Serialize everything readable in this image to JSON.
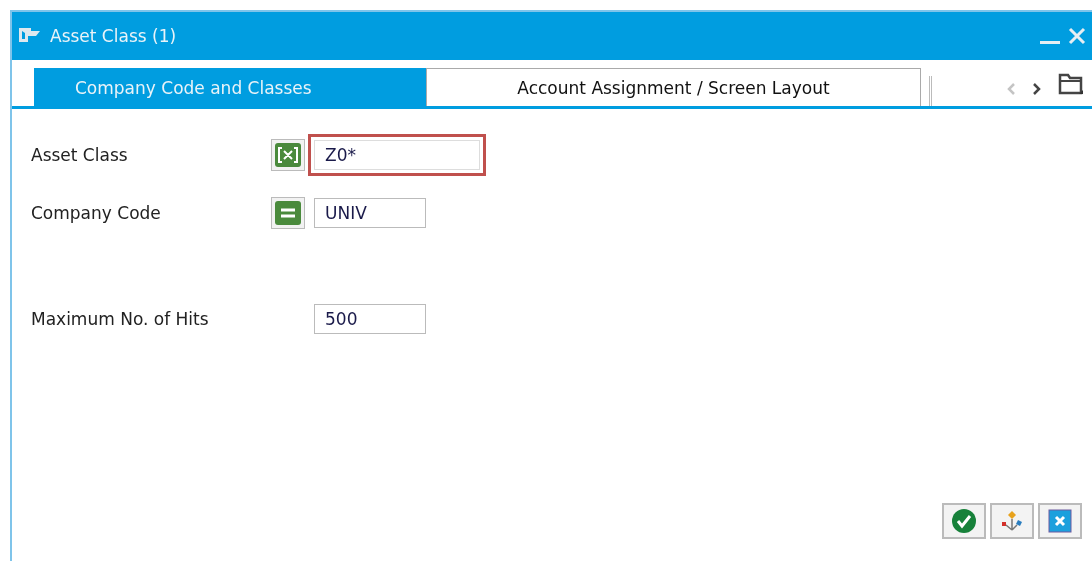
{
  "window": {
    "title": "Asset Class (1)"
  },
  "tabs": [
    {
      "label": "Company Code and Classes",
      "selected": true
    },
    {
      "label": "Account Assignment / Screen Layout",
      "selected": false
    }
  ],
  "fields": [
    {
      "label": "Asset Class",
      "kind": "pattern",
      "value": "Z0*",
      "focused": true
    },
    {
      "label": "Company Code",
      "kind": "equals",
      "value": "UNIV",
      "focused": false
    },
    {
      "label": "Maximum No. of Hits",
      "kind": "plain",
      "value": "500",
      "focused": false
    }
  ]
}
